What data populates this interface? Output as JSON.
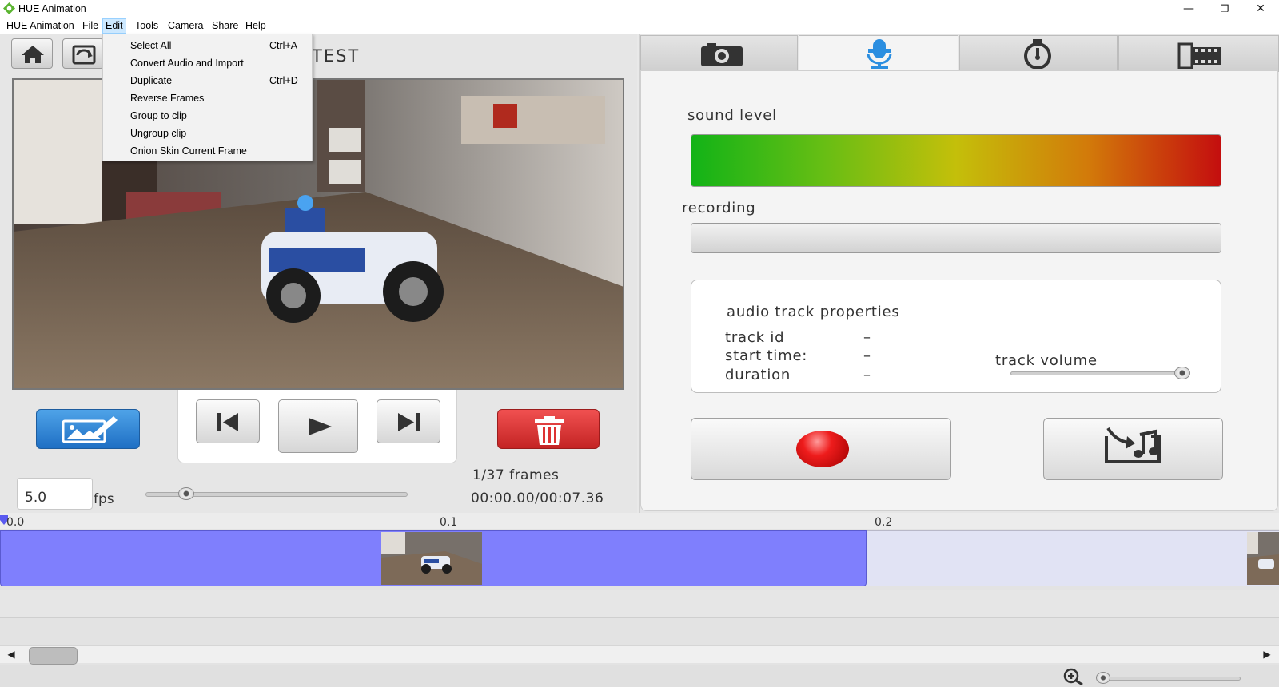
{
  "window": {
    "title": "HUE Animation",
    "minimize": "—",
    "maximize": "❐",
    "close": "✕"
  },
  "menubar": {
    "items": [
      "HUE Animation",
      "File",
      "Edit",
      "Tools",
      "Camera",
      "Share",
      "Help"
    ],
    "active": "Edit"
  },
  "edit_menu": {
    "items": [
      {
        "label": "Select All",
        "shortcut": "Ctrl+A"
      },
      {
        "label": "Convert Audio and Import",
        "shortcut": ""
      },
      {
        "label": "Duplicate",
        "shortcut": "Ctrl+D"
      },
      {
        "label": "Reverse Frames",
        "shortcut": ""
      },
      {
        "label": "Group to clip",
        "shortcut": ""
      },
      {
        "label": "Ungroup clip",
        "shortcut": ""
      },
      {
        "label": "Onion Skin Current Frame",
        "shortcut": ""
      }
    ]
  },
  "project": {
    "title": "TEST"
  },
  "playback": {
    "frames": "1/37 frames",
    "time": "00:00.00/00:07.36",
    "fps_value": "5.0",
    "fps_label": "fps",
    "fps_slider_level": 0.15
  },
  "tabs": [
    {
      "name": "camera",
      "icon": "camera-icon",
      "active": false
    },
    {
      "name": "audio",
      "icon": "microphone-icon",
      "active": true
    },
    {
      "name": "timer",
      "icon": "stopwatch-icon",
      "active": false
    },
    {
      "name": "export",
      "icon": "film-strip-icon",
      "active": false
    }
  ],
  "audio": {
    "sound_level_label": "sound level",
    "recording_label": "recording",
    "properties": {
      "title": "audio track properties",
      "rows": [
        {
          "label": "track id",
          "value": "–"
        },
        {
          "label": "start time:",
          "value": "–"
        },
        {
          "label": "duration",
          "value": "–"
        }
      ],
      "volume_label": "track volume",
      "volume_level": 0.97
    }
  },
  "timeline": {
    "ruler": [
      "0.0",
      "0.1",
      "0.2"
    ],
    "zoom_level": 0.0
  },
  "colors": {
    "clip": "#7f7ffd",
    "record": "#ee1c1c",
    "delete": "#d83232",
    "draw_button": "#2f84d6"
  }
}
